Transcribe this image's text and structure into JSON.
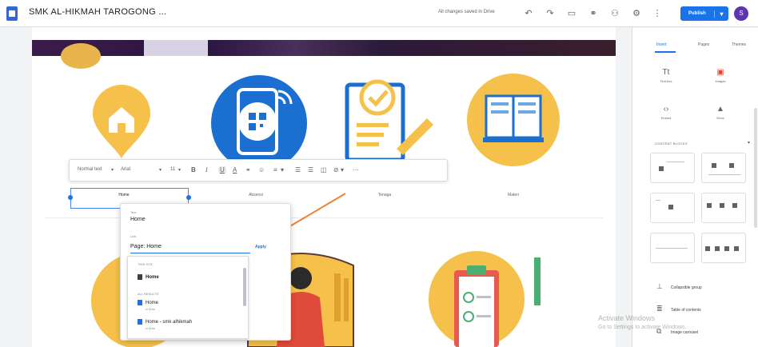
{
  "header": {
    "site_title": "SMK AL-HIKMAH TAROGONG ...",
    "draft_status": "All changes saved in Drive",
    "publish_label": "Publish",
    "avatar_initial": "S"
  },
  "toolbar": {
    "style_select": "Normal text",
    "font_select": "Arial",
    "font_size": "11",
    "bold": "B",
    "italic": "I",
    "underline": "U",
    "text_color": "A"
  },
  "canvas": {
    "captions": [
      "Home",
      "Absensi",
      "Tenaga",
      "Materi"
    ]
  },
  "link_popup": {
    "text_label": "Text",
    "text_value": "Home",
    "link_label": "Link",
    "link_value": "Page: Home",
    "apply_label": "Apply",
    "this_site_label": "THIS SITE",
    "page_item": "Home",
    "recent_label": "ALL RESULTS",
    "result_1_title": "Home",
    "result_1_sub": "In Drive",
    "result_2_title": "Home - smk alhikmah",
    "result_2_sub": "In Drive"
  },
  "panel": {
    "tabs": [
      "Insert",
      "Pages",
      "Themes"
    ],
    "insert_items": [
      "Text box",
      "Images",
      "Embed",
      "Drive"
    ],
    "section_label": "CONTENT BLOCKS",
    "components": [
      "Collapsible group",
      "Table of contents",
      "Image carousel"
    ]
  },
  "overlay": {
    "activation_title": "Activate Windows",
    "activation_sub": "Go to Settings to activate Windows."
  },
  "colors": {
    "accent": "#1a73e8",
    "icon_yellow": "#f6c14a",
    "icon_blue": "#1a6fd0",
    "annotation_arrow": "#f08030"
  }
}
